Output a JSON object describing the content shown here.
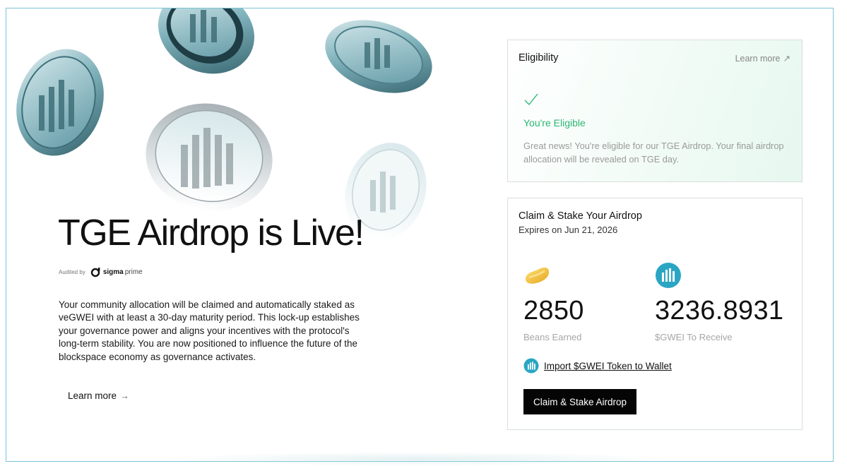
{
  "hero": {
    "title": "TGE Airdrop is Live!",
    "audited_by_label": "Audited by",
    "auditor_name_bold": "sigma",
    "auditor_name_light": "prime",
    "description": "Your community allocation will be claimed and automatically staked as veGWEI with at least a 30-day maturity period. This lock-up establishes your governance power and aligns your incentives with the protocol's long-term stability. You are now positioned to influence the future of the blockspace economy as governance activates.",
    "learn_more_label": "Learn more",
    "learn_more_icon": "arrow-right-icon"
  },
  "eligibility": {
    "title": "Eligibility",
    "learn_more_label": "Learn more",
    "learn_more_icon": "arrow-up-right-icon",
    "status_icon": "check-icon",
    "status": "You're Eligible",
    "description": "Great news! You're eligible for our TGE Airdrop. Your final airdrop allocation will be revealed on TGE day."
  },
  "claim": {
    "title": "Claim & Stake Your Airdrop",
    "expiry": "Expires on Jun 21, 2026",
    "beans": {
      "icon": "bean-icon",
      "value": "2850",
      "label": "Beans Earned"
    },
    "gwei": {
      "icon": "gwei-token-icon",
      "value": "3236.8931",
      "label": "$GWEI To Receive"
    },
    "import_label": "Import $GWEI Token to Wallet",
    "button_label": "Claim & Stake Airdrop"
  },
  "colors": {
    "accent_teal": "#2aa6c4",
    "eligible_green": "#2bb673",
    "button_black": "#050505",
    "frame_border": "#7cc3d6"
  }
}
